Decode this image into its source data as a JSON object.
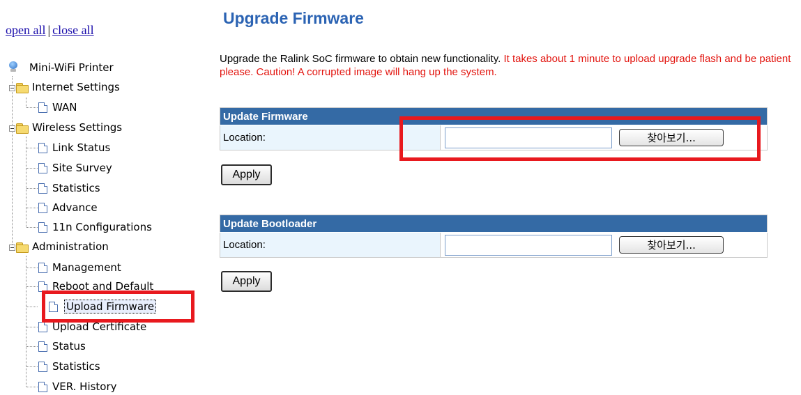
{
  "tree": {
    "open_all": "open all",
    "separator": "|",
    "close_all": "close all",
    "root": "Mini-WiFi Printer",
    "internet_settings": {
      "label": "Internet Settings",
      "items": [
        "WAN"
      ]
    },
    "wireless_settings": {
      "label": "Wireless Settings",
      "items": [
        "Link Status",
        "Site Survey",
        "Statistics",
        "Advance",
        "11n Configurations"
      ]
    },
    "administration": {
      "label": "Administration",
      "items": [
        "Management",
        "Reboot and Default",
        "Upload Firmware",
        "Upload Certificate",
        "Status",
        "Statistics",
        "VER. History"
      ]
    },
    "selected_item": "Upload Firmware"
  },
  "main": {
    "title": "Upgrade Firmware",
    "description_normal": "Upgrade the Ralink SoC firmware to obtain new functionality. ",
    "description_warning": "It takes about 1 minute to upload upgrade flash and be patient please. Caution! A corrupted image will hang up the system.",
    "firmware_section": {
      "header": "Update Firmware",
      "location_label": "Location:",
      "file_value": "",
      "browse_label": "찾아보기...",
      "apply_label": "Apply"
    },
    "bootloader_section": {
      "header": "Update Bootloader",
      "location_label": "Location:",
      "file_value": "",
      "browse_label": "찾아보기...",
      "apply_label": "Apply"
    }
  },
  "colors": {
    "title": "#2b63b3",
    "table_header": "#346aa5",
    "label_cell": "#eaf5fd",
    "warning_text": "#e2140e",
    "highlight_box": "#e8191e"
  }
}
